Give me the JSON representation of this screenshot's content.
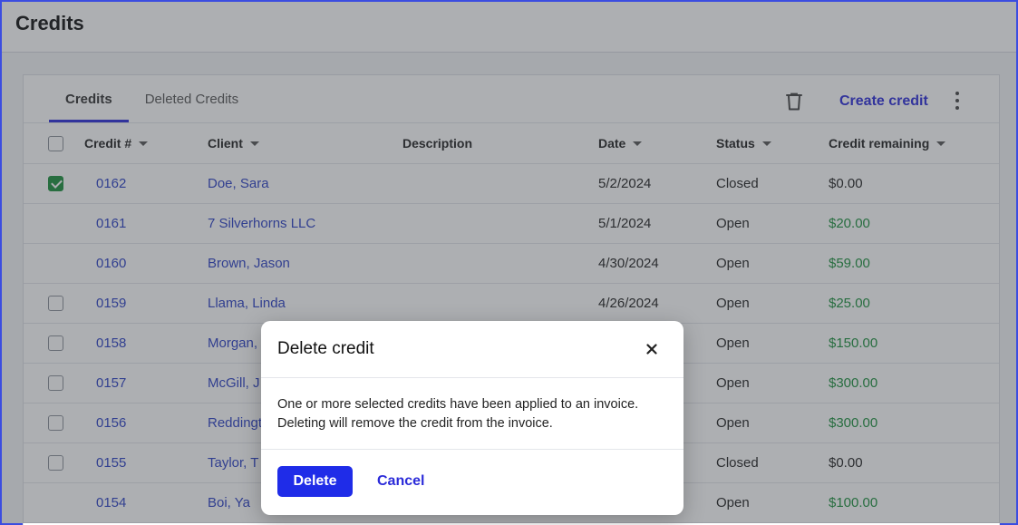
{
  "page": {
    "title": "Credits"
  },
  "tabs": [
    {
      "label": "Credits",
      "active": true
    },
    {
      "label": "Deleted Credits",
      "active": false
    }
  ],
  "toolbar": {
    "create_label": "Create credit"
  },
  "table": {
    "headers": {
      "number": "Credit #",
      "client": "Client",
      "description": "Description",
      "date": "Date",
      "status": "Status",
      "credit_remaining": "Credit remaining"
    },
    "rows": [
      {
        "number": "0162",
        "client": "Doe, Sara",
        "description": "",
        "date": "5/2/2024",
        "status": "Closed",
        "credit": "$0.00",
        "checkbox": "checked"
      },
      {
        "number": "0161",
        "client": "7 Silverhorns LLC",
        "description": "",
        "date": "5/1/2024",
        "status": "Open",
        "credit": "$20.00",
        "checkbox": "none"
      },
      {
        "number": "0160",
        "client": "Brown, Jason",
        "description": "",
        "date": "4/30/2024",
        "status": "Open",
        "credit": "$59.00",
        "checkbox": "none"
      },
      {
        "number": "0159",
        "client": "Llama, Linda",
        "description": "",
        "date": "4/26/2024",
        "status": "Open",
        "credit": "$25.00",
        "checkbox": "unchecked"
      },
      {
        "number": "0158",
        "client": "Morgan, ",
        "description": "",
        "date": "",
        "status": "Open",
        "credit": "$150.00",
        "checkbox": "unchecked"
      },
      {
        "number": "0157",
        "client": "McGill, J",
        "description": "",
        "date": "",
        "status": "Open",
        "credit": "$300.00",
        "checkbox": "unchecked"
      },
      {
        "number": "0156",
        "client": "Reddingt",
        "description": "",
        "date": "",
        "status": "Open",
        "credit": "$300.00",
        "checkbox": "unchecked"
      },
      {
        "number": "0155",
        "client": "Taylor, T",
        "description": "",
        "date": "",
        "status": "Closed",
        "credit": "$0.00",
        "checkbox": "unchecked"
      },
      {
        "number": "0154",
        "client": "Boi, Ya",
        "description": "",
        "date": "",
        "status": "Open",
        "credit": "$100.00",
        "checkbox": "none"
      }
    ]
  },
  "modal": {
    "title": "Delete credit",
    "body_line1": "One or more selected credits have been applied to an invoice.",
    "body_line2": "Deleting will remove the credit from the invoice.",
    "delete_label": "Delete",
    "cancel_label": "Cancel"
  },
  "colors": {
    "accent": "#2b2bd9",
    "primary_button": "#1f2ce8",
    "positive": "#1a8f3c",
    "link": "#2a3fc4"
  },
  "icons": {
    "trash": "trash-icon",
    "kebab": "more-vertical-icon",
    "close": "close-icon",
    "caret": "caret-down-icon"
  }
}
